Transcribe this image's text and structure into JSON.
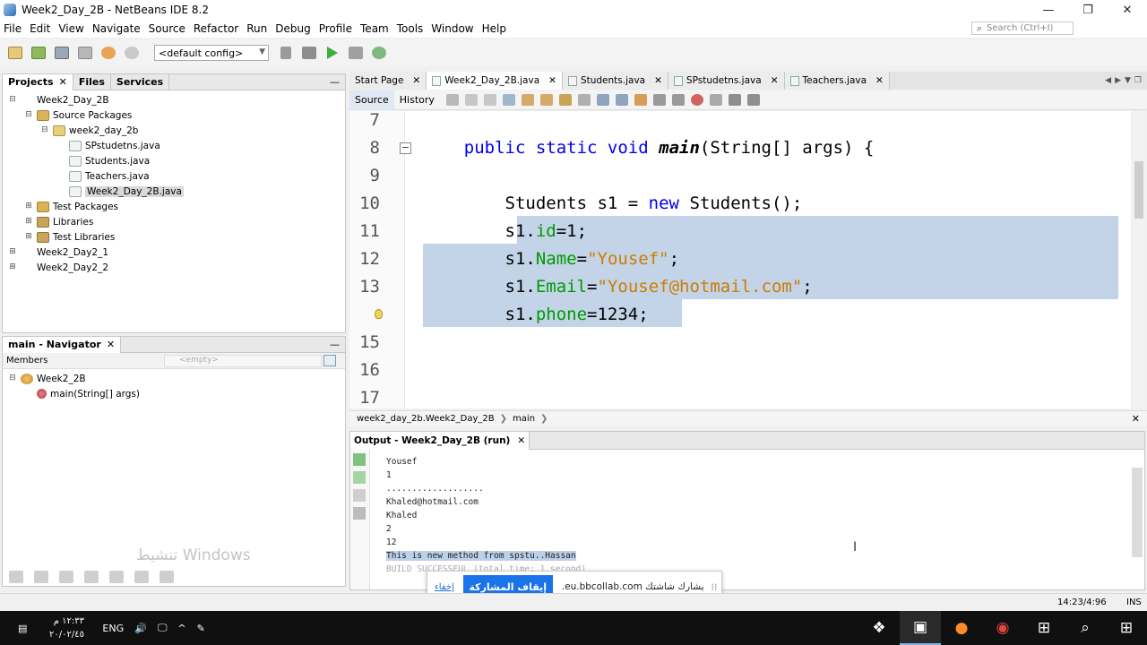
{
  "window": {
    "title": "Week2_Day_2B - NetBeans IDE 8.2",
    "controls": [
      "—",
      "❐",
      "✕"
    ]
  },
  "menu": [
    "File",
    "Edit",
    "View",
    "Navigate",
    "Source",
    "Refactor",
    "Run",
    "Debug",
    "Profile",
    "Team",
    "Tools",
    "Window",
    "Help"
  ],
  "search": {
    "placeholder": "Search (Ctrl+I)"
  },
  "toolbar": {
    "config": "<default config>"
  },
  "projects": {
    "tabs": [
      "Projects",
      "Files",
      "Services"
    ],
    "tree": [
      {
        "label": "Week2_Day_2B",
        "toggle": "⊟",
        "icon": "project",
        "indent": 0
      },
      {
        "label": "Source Packages",
        "toggle": "⊟",
        "icon": "pkgs",
        "indent": 1
      },
      {
        "label": "week2_day_2b",
        "toggle": "⊟",
        "icon": "pkg",
        "indent": 2
      },
      {
        "label": "SPstudetns.java",
        "toggle": "",
        "icon": "file",
        "indent": 3
      },
      {
        "label": "Students.java",
        "toggle": "",
        "icon": "file",
        "indent": 3
      },
      {
        "label": "Teachers.java",
        "toggle": "",
        "icon": "file",
        "indent": 3
      },
      {
        "label": "Week2_Day_2B.java",
        "toggle": "",
        "icon": "file",
        "indent": 3,
        "selected": true
      },
      {
        "label": "Test Packages",
        "toggle": "⊞",
        "icon": "pkgs",
        "indent": 1
      },
      {
        "label": "Libraries",
        "toggle": "⊞",
        "icon": "lib",
        "indent": 1
      },
      {
        "label": "Test Libraries",
        "toggle": "⊞",
        "icon": "lib",
        "indent": 1
      },
      {
        "label": "Week2_Day2_1",
        "toggle": "⊞",
        "icon": "project",
        "indent": 0
      },
      {
        "label": "Week2_Day2_2",
        "toggle": "⊞",
        "icon": "project",
        "indent": 0
      }
    ]
  },
  "navigator": {
    "title": "main - Navigator",
    "members_label": "Members",
    "filter_placeholder": "<empty>",
    "tree": [
      {
        "label": "Week2_2B",
        "toggle": "⊟",
        "icon": "class",
        "indent": 0
      },
      {
        "label": "main(String[] args)",
        "toggle": "",
        "icon": "method",
        "indent": 1
      }
    ]
  },
  "watermark": "تنشيط Windows",
  "editor": {
    "tabs": [
      {
        "label": "Start Page",
        "icon": false
      },
      {
        "label": "Week2_Day_2B.java",
        "icon": true,
        "active": true
      },
      {
        "label": "Students.java",
        "icon": true
      },
      {
        "label": "SPstudetns.java",
        "icon": true
      },
      {
        "label": "Teachers.java",
        "icon": true
      }
    ],
    "view_tabs": [
      "Source",
      "History"
    ],
    "lines": [
      {
        "num": "7",
        "html": ""
      },
      {
        "num": "8",
        "fold": true,
        "html": "    <span class=\"kw\">public static void</span> <span class=\"m\">main</span>(String[] args) {"
      },
      {
        "num": "9",
        "html": ""
      },
      {
        "num": "10",
        "html": "        Students s1 = <span class=\"kw\">new</span> Students();"
      },
      {
        "num": "11",
        "html": "        s1.<span class=\"fld\">id</span>=1;"
      },
      {
        "num": "12",
        "html": "        s1.<span class=\"fld\">Name</span>=<span class=\"str\">\"Yousef\"</span>;"
      },
      {
        "num": "13",
        "html": "        s1.<span class=\"fld\">Email</span>=<span class=\"str\">\"Yousef@hotmail.com\"</span>;"
      },
      {
        "num": "",
        "bulb": true,
        "html": "        s1.<span class=\"fld\">phone</span>=1234;"
      },
      {
        "num": "15",
        "html": ""
      },
      {
        "num": "16",
        "html": ""
      },
      {
        "num": "17",
        "html": ""
      }
    ],
    "breadcrumb": [
      "week2_day_2b.Week2_Day_2B",
      "main"
    ]
  },
  "output": {
    "title": "Output - Week2_Day_2B (run)",
    "lines": [
      {
        "text": "Yousef"
      },
      {
        "text": "1"
      },
      {
        "text": "..................."
      },
      {
        "text": "Khaled@hotmail.com"
      },
      {
        "text": "Khaled"
      },
      {
        "text": "2"
      },
      {
        "text": "12"
      },
      {
        "text": "This is new method from spstu..Hassan",
        "highlight": true
      },
      {
        "text": "BUILD SUCCESSFUL (total time: 1 second)",
        "faded": true
      }
    ]
  },
  "share_bar": {
    "hide": "إخفاء",
    "stop": "إيقاف المشاركة",
    "text": "يشارك شاشتك eu.bbcollab.com."
  },
  "status": {
    "position": "14:23/4:96",
    "mode": "INS"
  },
  "taskbar": {
    "lang": "ENG",
    "time": "١٢:٣٣ م",
    "date": "٢٠/٠٢/٤٥"
  },
  "colors": {
    "selection": "#c3d4e8",
    "keyword": "#0000e6",
    "field": "#009900",
    "string": "#ce7b00",
    "share_button": "#1a73e8"
  }
}
